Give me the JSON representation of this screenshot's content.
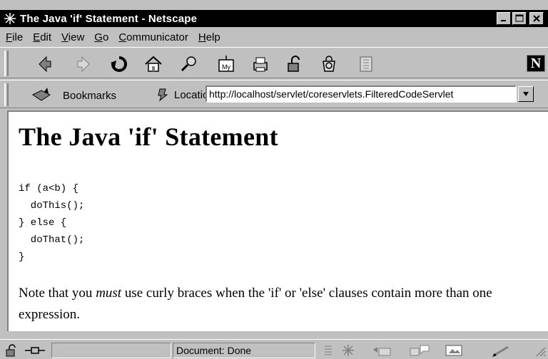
{
  "window": {
    "title": "The Java 'if' Statement - Netscape",
    "controls": [
      "minimize",
      "maximize",
      "close"
    ]
  },
  "menubar": {
    "items": [
      "File",
      "Edit",
      "View",
      "Go",
      "Communicator",
      "Help"
    ]
  },
  "toolbar": {
    "icons": [
      "back-icon",
      "forward-icon",
      "reload-icon",
      "home-icon",
      "search-icon",
      "my-netscape-icon",
      "print-icon",
      "security-icon",
      "shop-icon",
      "stop-icon"
    ]
  },
  "locbar": {
    "bookmarks_label": "Bookmarks",
    "location_label": "Location:",
    "url": "http://localhost/servlet/coreservlets.FilteredCodeServlet"
  },
  "content": {
    "heading": "The Java 'if' Statement",
    "code_lines": [
      "if (a<b) {",
      "  doThis();",
      "} else {",
      "  doThat();",
      "}"
    ],
    "note_before": "Note that you ",
    "note_em": "must",
    "note_after": " use curly braces when the 'if' or 'else' clauses contain more than one expression."
  },
  "statusbar": {
    "status_text": "Document: Done"
  }
}
